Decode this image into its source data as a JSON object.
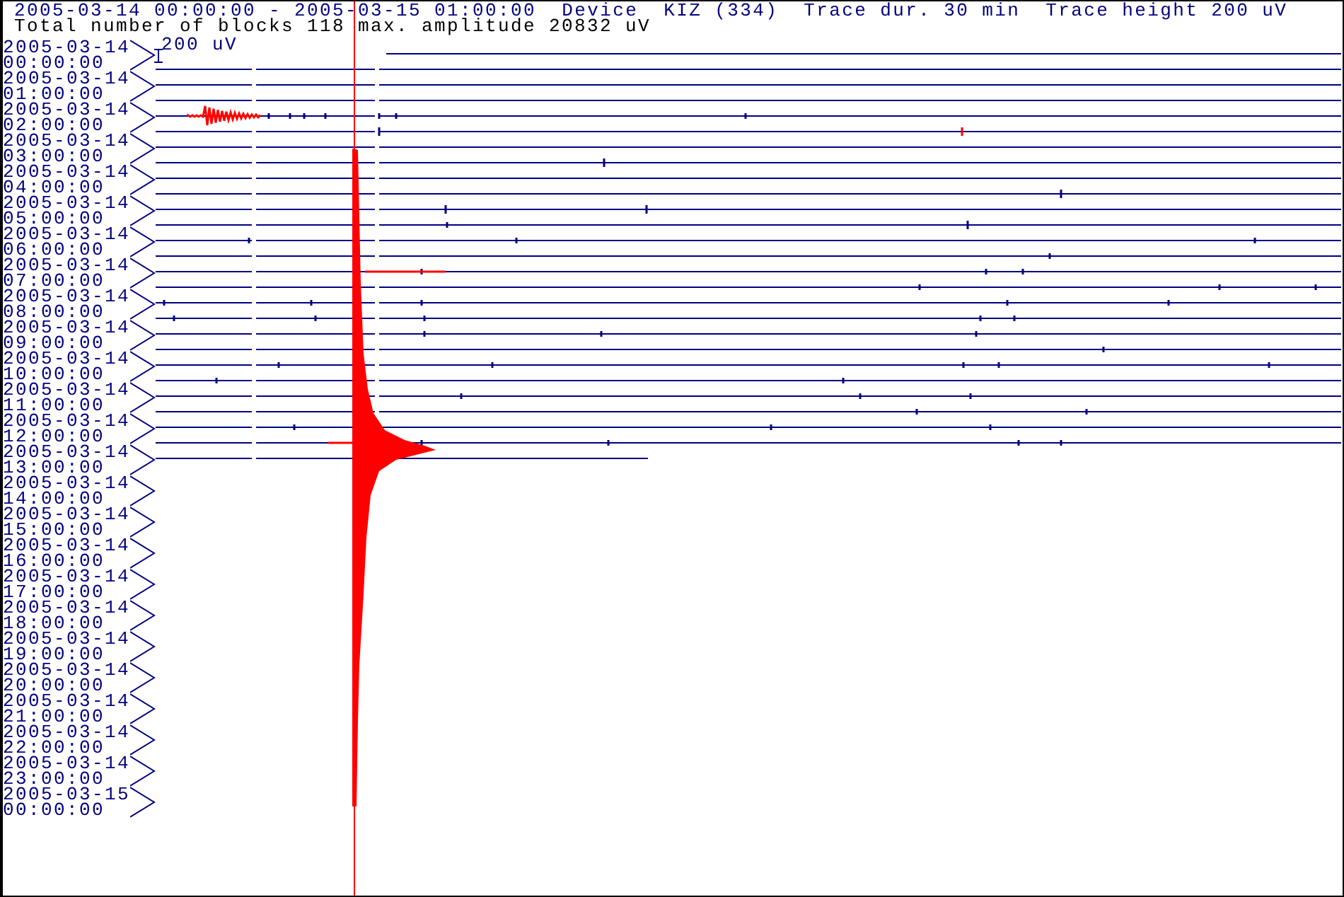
{
  "header": {
    "time_range": "2005-03-14 00:00:00 - 2005-03-15 01:00:00",
    "device": "Device  KIZ (334)",
    "trace_duration": "Trace dur. 30 min",
    "trace_height": "Trace height 200 uV"
  },
  "summary": "Total number of blocks 118 max. amplitude 20832 uV",
  "scale_label": "200 uV",
  "time_labels": [
    {
      "date": "2005-03-14",
      "time": "00:00:00"
    },
    {
      "date": "2005-03-14",
      "time": "01:00:00"
    },
    {
      "date": "2005-03-14",
      "time": "02:00:00"
    },
    {
      "date": "2005-03-14",
      "time": "03:00:00"
    },
    {
      "date": "2005-03-14",
      "time": "04:00:00"
    },
    {
      "date": "2005-03-14",
      "time": "05:00:00"
    },
    {
      "date": "2005-03-14",
      "time": "06:00:00"
    },
    {
      "date": "2005-03-14",
      "time": "07:00:00"
    },
    {
      "date": "2005-03-14",
      "time": "08:00:00"
    },
    {
      "date": "2005-03-14",
      "time": "09:00:00"
    },
    {
      "date": "2005-03-14",
      "time": "10:00:00"
    },
    {
      "date": "2005-03-14",
      "time": "11:00:00"
    },
    {
      "date": "2005-03-14",
      "time": "12:00:00"
    },
    {
      "date": "2005-03-14",
      "time": "13:00:00"
    },
    {
      "date": "2005-03-14",
      "time": "14:00:00"
    },
    {
      "date": "2005-03-14",
      "time": "15:00:00"
    },
    {
      "date": "2005-03-14",
      "time": "16:00:00"
    },
    {
      "date": "2005-03-14",
      "time": "17:00:00"
    },
    {
      "date": "2005-03-14",
      "time": "18:00:00"
    },
    {
      "date": "2005-03-14",
      "time": "19:00:00"
    },
    {
      "date": "2005-03-14",
      "time": "20:00:00"
    },
    {
      "date": "2005-03-14",
      "time": "21:00:00"
    },
    {
      "date": "2005-03-14",
      "time": "22:00:00"
    },
    {
      "date": "2005-03-14",
      "time": "23:00:00"
    },
    {
      "date": "2005-03-15",
      "time": "00:00:00"
    }
  ]
}
